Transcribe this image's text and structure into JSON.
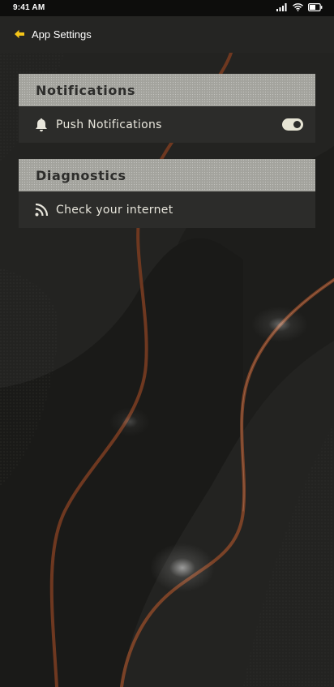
{
  "status_bar": {
    "time": "9:41 AM",
    "icons": [
      "signal-icon",
      "wifi-icon",
      "battery-icon"
    ]
  },
  "app_bar": {
    "back_icon": "arrow-left-icon",
    "title": "App Settings",
    "accent_color": "#f5c518"
  },
  "sections": {
    "notifications": {
      "title": "Notifications",
      "items": [
        {
          "label": "Push Notifications",
          "icon": "bell-icon",
          "toggle_on": true
        }
      ]
    },
    "diagnostics": {
      "title": "Diagnostics",
      "items": [
        {
          "label": "Check your internet",
          "icon": "rss-icon"
        }
      ]
    }
  },
  "colors": {
    "background": "#1d1d1b",
    "card": "#2c2c2a",
    "card_header": "#a3a39d",
    "wave_accent": "#8a4a2a"
  }
}
